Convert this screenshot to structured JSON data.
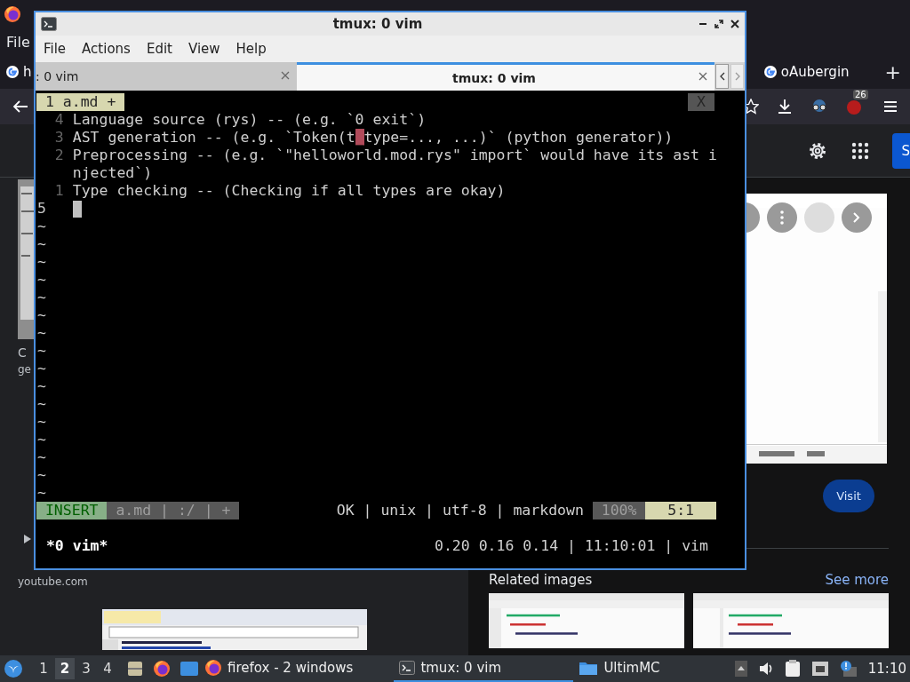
{
  "browser": {
    "menu": [
      "File"
    ],
    "tabs": [
      {
        "label": "h"
      },
      {
        "label": "oAubergin"
      }
    ],
    "new_tab": "+",
    "notification_badge": "26",
    "header_button": "S",
    "left_texts": [
      "C",
      "ge"
    ],
    "source": "youtube.com",
    "visit_button": "Visit",
    "related_heading": "Related images",
    "see_more": "See more"
  },
  "terminal": {
    "title": "tmux: 0 vim",
    "menu": [
      "File",
      "Actions",
      "Edit",
      "View",
      "Help"
    ],
    "tabs": [
      {
        "label": ": 0 vim",
        "selected": false
      },
      {
        "label": "tmux: 0 vim",
        "selected": true
      }
    ],
    "vim": {
      "tabline": {
        "label": " 1 a.md + ",
        "close": " X "
      },
      "lines": [
        {
          "number": "4",
          "current": false,
          "parts": [
            {
              "kind": "normal",
              "text": "Language source (rys) -- (e.g. `0 exit`)"
            }
          ]
        },
        {
          "number": "3",
          "current": false,
          "parts": [
            {
              "kind": "normal",
              "text": "AST generation -- (e.g. `Token(t"
            },
            {
              "kind": "error",
              "text": "_"
            },
            {
              "kind": "normal",
              "text": "type=..., ...)` (python generator))"
            }
          ]
        },
        {
          "number": "2",
          "current": false,
          "parts": [
            {
              "kind": "normal",
              "text": "Preprocessing -- (e.g. `\"helloworld.mod.rys\" import` would have its ast i"
            }
          ],
          "wrap": "njected`)"
        },
        {
          "number": "1",
          "current": false,
          "parts": [
            {
              "kind": "normal",
              "text": "Type checking -- (Checking if all types are okay)"
            }
          ]
        },
        {
          "number": "5",
          "current": true
        }
      ],
      "filler": [
        "~",
        "~",
        "~",
        "~",
        "~",
        "~",
        "~",
        "~",
        "~",
        "~",
        "~",
        "~",
        "~",
        "~",
        "~",
        "~"
      ],
      "statusline": {
        "mode": "INSERT",
        "file_info": "a.md | :/ | +",
        "file_meta": "OK | unix | utf-8 | markdown",
        "percent": "100%",
        "position": "5:1"
      }
    },
    "tmux_status": {
      "window": "*0 vim*",
      "info": "0.20 0.16 0.14 | 11:10:01 | vim"
    }
  },
  "taskbar": {
    "workspaces": [
      {
        "label": "1",
        "selected": false
      },
      {
        "label": "2",
        "selected": true
      },
      {
        "label": "3",
        "selected": false
      },
      {
        "label": "4",
        "selected": false
      }
    ],
    "tasks": [
      {
        "kind": "firefox",
        "label": "firefox - 2 windows",
        "selected": false
      },
      {
        "kind": "terminal",
        "label": "tmux: 0 vim",
        "selected": true
      },
      {
        "kind": "folder",
        "label": "UltimMC",
        "selected": false
      }
    ],
    "clock": "11:10"
  }
}
